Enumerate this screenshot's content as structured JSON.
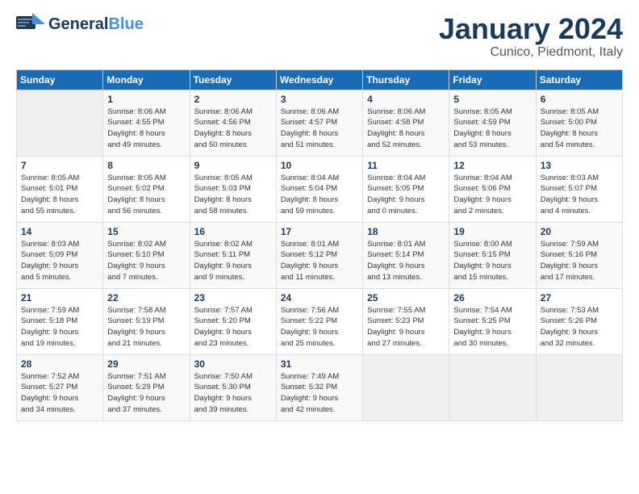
{
  "header": {
    "logo_general": "General",
    "logo_blue": "Blue",
    "month": "January 2024",
    "location": "Cunico, Piedmont, Italy"
  },
  "days_of_week": [
    "Sunday",
    "Monday",
    "Tuesday",
    "Wednesday",
    "Thursday",
    "Friday",
    "Saturday"
  ],
  "weeks": [
    [
      {
        "day": "",
        "info": ""
      },
      {
        "day": "1",
        "info": "Sunrise: 8:06 AM\nSunset: 4:55 PM\nDaylight: 8 hours\nand 49 minutes."
      },
      {
        "day": "2",
        "info": "Sunrise: 8:06 AM\nSunset: 4:56 PM\nDaylight: 8 hours\nand 50 minutes."
      },
      {
        "day": "3",
        "info": "Sunrise: 8:06 AM\nSunset: 4:57 PM\nDaylight: 8 hours\nand 51 minutes."
      },
      {
        "day": "4",
        "info": "Sunrise: 8:06 AM\nSunset: 4:58 PM\nDaylight: 8 hours\nand 52 minutes."
      },
      {
        "day": "5",
        "info": "Sunrise: 8:05 AM\nSunset: 4:59 PM\nDaylight: 8 hours\nand 53 minutes."
      },
      {
        "day": "6",
        "info": "Sunrise: 8:05 AM\nSunset: 5:00 PM\nDaylight: 8 hours\nand 54 minutes."
      }
    ],
    [
      {
        "day": "7",
        "info": "Sunrise: 8:05 AM\nSunset: 5:01 PM\nDaylight: 8 hours\nand 55 minutes."
      },
      {
        "day": "8",
        "info": "Sunrise: 8:05 AM\nSunset: 5:02 PM\nDaylight: 8 hours\nand 56 minutes."
      },
      {
        "day": "9",
        "info": "Sunrise: 8:05 AM\nSunset: 5:03 PM\nDaylight: 8 hours\nand 58 minutes."
      },
      {
        "day": "10",
        "info": "Sunrise: 8:04 AM\nSunset: 5:04 PM\nDaylight: 8 hours\nand 59 minutes."
      },
      {
        "day": "11",
        "info": "Sunrise: 8:04 AM\nSunset: 5:05 PM\nDaylight: 9 hours\nand 0 minutes."
      },
      {
        "day": "12",
        "info": "Sunrise: 8:04 AM\nSunset: 5:06 PM\nDaylight: 9 hours\nand 2 minutes."
      },
      {
        "day": "13",
        "info": "Sunrise: 8:03 AM\nSunset: 5:07 PM\nDaylight: 9 hours\nand 4 minutes."
      }
    ],
    [
      {
        "day": "14",
        "info": "Sunrise: 8:03 AM\nSunset: 5:09 PM\nDaylight: 9 hours\nand 5 minutes."
      },
      {
        "day": "15",
        "info": "Sunrise: 8:02 AM\nSunset: 5:10 PM\nDaylight: 9 hours\nand 7 minutes."
      },
      {
        "day": "16",
        "info": "Sunrise: 8:02 AM\nSunset: 5:11 PM\nDaylight: 9 hours\nand 9 minutes."
      },
      {
        "day": "17",
        "info": "Sunrise: 8:01 AM\nSunset: 5:12 PM\nDaylight: 9 hours\nand 11 minutes."
      },
      {
        "day": "18",
        "info": "Sunrise: 8:01 AM\nSunset: 5:14 PM\nDaylight: 9 hours\nand 13 minutes."
      },
      {
        "day": "19",
        "info": "Sunrise: 8:00 AM\nSunset: 5:15 PM\nDaylight: 9 hours\nand 15 minutes."
      },
      {
        "day": "20",
        "info": "Sunrise: 7:59 AM\nSunset: 5:16 PM\nDaylight: 9 hours\nand 17 minutes."
      }
    ],
    [
      {
        "day": "21",
        "info": "Sunrise: 7:59 AM\nSunset: 5:18 PM\nDaylight: 9 hours\nand 19 minutes."
      },
      {
        "day": "22",
        "info": "Sunrise: 7:58 AM\nSunset: 5:19 PM\nDaylight: 9 hours\nand 21 minutes."
      },
      {
        "day": "23",
        "info": "Sunrise: 7:57 AM\nSunset: 5:20 PM\nDaylight: 9 hours\nand 23 minutes."
      },
      {
        "day": "24",
        "info": "Sunrise: 7:56 AM\nSunset: 5:22 PM\nDaylight: 9 hours\nand 25 minutes."
      },
      {
        "day": "25",
        "info": "Sunrise: 7:55 AM\nSunset: 5:23 PM\nDaylight: 9 hours\nand 27 minutes."
      },
      {
        "day": "26",
        "info": "Sunrise: 7:54 AM\nSunset: 5:25 PM\nDaylight: 9 hours\nand 30 minutes."
      },
      {
        "day": "27",
        "info": "Sunrise: 7:53 AM\nSunset: 5:26 PM\nDaylight: 9 hours\nand 32 minutes."
      }
    ],
    [
      {
        "day": "28",
        "info": "Sunrise: 7:52 AM\nSunset: 5:27 PM\nDaylight: 9 hours\nand 34 minutes."
      },
      {
        "day": "29",
        "info": "Sunrise: 7:51 AM\nSunset: 5:29 PM\nDaylight: 9 hours\nand 37 minutes."
      },
      {
        "day": "30",
        "info": "Sunrise: 7:50 AM\nSunset: 5:30 PM\nDaylight: 9 hours\nand 39 minutes."
      },
      {
        "day": "31",
        "info": "Sunrise: 7:49 AM\nSunset: 5:32 PM\nDaylight: 9 hours\nand 42 minutes."
      },
      {
        "day": "",
        "info": ""
      },
      {
        "day": "",
        "info": ""
      },
      {
        "day": "",
        "info": ""
      }
    ]
  ]
}
